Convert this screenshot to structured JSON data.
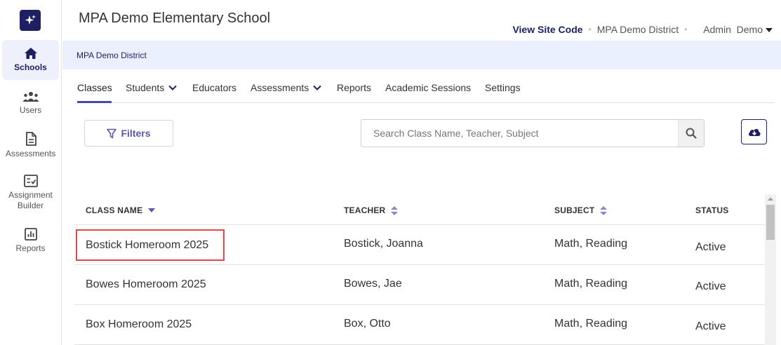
{
  "app": {
    "title": "MPA Demo Elementary School"
  },
  "topbar": {
    "site_code": "View Site Code",
    "district": "MPA Demo District",
    "user": "Admin  Demo"
  },
  "sidebar": {
    "items": [
      {
        "label": "Schools",
        "icon": "home-icon",
        "active": true
      },
      {
        "label": "Users",
        "icon": "users-icon",
        "active": false
      },
      {
        "label": "Assessments",
        "icon": "document-icon",
        "active": false
      },
      {
        "label": "Assignment Builder",
        "icon": "checklist-icon",
        "active": false
      },
      {
        "label": "Reports",
        "icon": "bar-chart-icon",
        "active": false
      }
    ]
  },
  "breadcrumb": {
    "text": "MPA Demo District"
  },
  "tabs": [
    {
      "label": "Classes",
      "active": true,
      "has_dropdown": false
    },
    {
      "label": "Students",
      "active": false,
      "has_dropdown": true
    },
    {
      "label": "Educators",
      "active": false,
      "has_dropdown": false
    },
    {
      "label": "Assessments",
      "active": false,
      "has_dropdown": true
    },
    {
      "label": "Reports",
      "active": false,
      "has_dropdown": false
    },
    {
      "label": "Academic Sessions",
      "active": false,
      "has_dropdown": false
    },
    {
      "label": "Settings",
      "active": false,
      "has_dropdown": false
    }
  ],
  "toolbar": {
    "filters_label": "Filters",
    "search_placeholder": "Search Class Name, Teacher, Subject",
    "search_value": ""
  },
  "table": {
    "columns": [
      "CLASS NAME",
      "TEACHER",
      "SUBJECT",
      "STATUS"
    ],
    "rows": [
      {
        "class_name": "Bostick Homeroom 2025",
        "teacher": "Bostick, Joanna",
        "subject": "Math, Reading",
        "status": "Active",
        "highlighted": true
      },
      {
        "class_name": "Bowes Homeroom 2025",
        "teacher": "Bowes, Jae",
        "subject": "Math, Reading",
        "status": "Active",
        "highlighted": false
      },
      {
        "class_name": "Box Homeroom 2025",
        "teacher": "Box, Otto",
        "subject": "Math, Reading",
        "status": "Active",
        "highlighted": false
      }
    ]
  },
  "colors": {
    "brand_navy": "#1e1f63",
    "accent_purple": "#4a46a8",
    "band_blue": "#eaf0fd",
    "highlight_red": "#e34848"
  }
}
